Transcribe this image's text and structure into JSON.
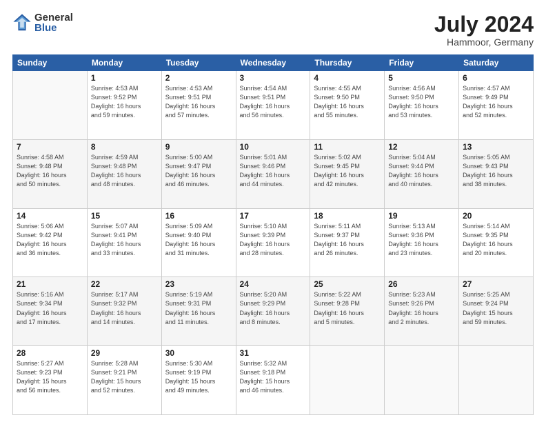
{
  "logo": {
    "general": "General",
    "blue": "Blue"
  },
  "header": {
    "month_year": "July 2024",
    "location": "Hammoor, Germany"
  },
  "weekdays": [
    "Sunday",
    "Monday",
    "Tuesday",
    "Wednesday",
    "Thursday",
    "Friday",
    "Saturday"
  ],
  "weeks": [
    [
      {
        "day": "",
        "info": ""
      },
      {
        "day": "1",
        "info": "Sunrise: 4:53 AM\nSunset: 9:52 PM\nDaylight: 16 hours\nand 59 minutes."
      },
      {
        "day": "2",
        "info": "Sunrise: 4:53 AM\nSunset: 9:51 PM\nDaylight: 16 hours\nand 57 minutes."
      },
      {
        "day": "3",
        "info": "Sunrise: 4:54 AM\nSunset: 9:51 PM\nDaylight: 16 hours\nand 56 minutes."
      },
      {
        "day": "4",
        "info": "Sunrise: 4:55 AM\nSunset: 9:50 PM\nDaylight: 16 hours\nand 55 minutes."
      },
      {
        "day": "5",
        "info": "Sunrise: 4:56 AM\nSunset: 9:50 PM\nDaylight: 16 hours\nand 53 minutes."
      },
      {
        "day": "6",
        "info": "Sunrise: 4:57 AM\nSunset: 9:49 PM\nDaylight: 16 hours\nand 52 minutes."
      }
    ],
    [
      {
        "day": "7",
        "info": "Sunrise: 4:58 AM\nSunset: 9:48 PM\nDaylight: 16 hours\nand 50 minutes."
      },
      {
        "day": "8",
        "info": "Sunrise: 4:59 AM\nSunset: 9:48 PM\nDaylight: 16 hours\nand 48 minutes."
      },
      {
        "day": "9",
        "info": "Sunrise: 5:00 AM\nSunset: 9:47 PM\nDaylight: 16 hours\nand 46 minutes."
      },
      {
        "day": "10",
        "info": "Sunrise: 5:01 AM\nSunset: 9:46 PM\nDaylight: 16 hours\nand 44 minutes."
      },
      {
        "day": "11",
        "info": "Sunrise: 5:02 AM\nSunset: 9:45 PM\nDaylight: 16 hours\nand 42 minutes."
      },
      {
        "day": "12",
        "info": "Sunrise: 5:04 AM\nSunset: 9:44 PM\nDaylight: 16 hours\nand 40 minutes."
      },
      {
        "day": "13",
        "info": "Sunrise: 5:05 AM\nSunset: 9:43 PM\nDaylight: 16 hours\nand 38 minutes."
      }
    ],
    [
      {
        "day": "14",
        "info": "Sunrise: 5:06 AM\nSunset: 9:42 PM\nDaylight: 16 hours\nand 36 minutes."
      },
      {
        "day": "15",
        "info": "Sunrise: 5:07 AM\nSunset: 9:41 PM\nDaylight: 16 hours\nand 33 minutes."
      },
      {
        "day": "16",
        "info": "Sunrise: 5:09 AM\nSunset: 9:40 PM\nDaylight: 16 hours\nand 31 minutes."
      },
      {
        "day": "17",
        "info": "Sunrise: 5:10 AM\nSunset: 9:39 PM\nDaylight: 16 hours\nand 28 minutes."
      },
      {
        "day": "18",
        "info": "Sunrise: 5:11 AM\nSunset: 9:37 PM\nDaylight: 16 hours\nand 26 minutes."
      },
      {
        "day": "19",
        "info": "Sunrise: 5:13 AM\nSunset: 9:36 PM\nDaylight: 16 hours\nand 23 minutes."
      },
      {
        "day": "20",
        "info": "Sunrise: 5:14 AM\nSunset: 9:35 PM\nDaylight: 16 hours\nand 20 minutes."
      }
    ],
    [
      {
        "day": "21",
        "info": "Sunrise: 5:16 AM\nSunset: 9:34 PM\nDaylight: 16 hours\nand 17 minutes."
      },
      {
        "day": "22",
        "info": "Sunrise: 5:17 AM\nSunset: 9:32 PM\nDaylight: 16 hours\nand 14 minutes."
      },
      {
        "day": "23",
        "info": "Sunrise: 5:19 AM\nSunset: 9:31 PM\nDaylight: 16 hours\nand 11 minutes."
      },
      {
        "day": "24",
        "info": "Sunrise: 5:20 AM\nSunset: 9:29 PM\nDaylight: 16 hours\nand 8 minutes."
      },
      {
        "day": "25",
        "info": "Sunrise: 5:22 AM\nSunset: 9:28 PM\nDaylight: 16 hours\nand 5 minutes."
      },
      {
        "day": "26",
        "info": "Sunrise: 5:23 AM\nSunset: 9:26 PM\nDaylight: 16 hours\nand 2 minutes."
      },
      {
        "day": "27",
        "info": "Sunrise: 5:25 AM\nSunset: 9:24 PM\nDaylight: 15 hours\nand 59 minutes."
      }
    ],
    [
      {
        "day": "28",
        "info": "Sunrise: 5:27 AM\nSunset: 9:23 PM\nDaylight: 15 hours\nand 56 minutes."
      },
      {
        "day": "29",
        "info": "Sunrise: 5:28 AM\nSunset: 9:21 PM\nDaylight: 15 hours\nand 52 minutes."
      },
      {
        "day": "30",
        "info": "Sunrise: 5:30 AM\nSunset: 9:19 PM\nDaylight: 15 hours\nand 49 minutes."
      },
      {
        "day": "31",
        "info": "Sunrise: 5:32 AM\nSunset: 9:18 PM\nDaylight: 15 hours\nand 46 minutes."
      },
      {
        "day": "",
        "info": ""
      },
      {
        "day": "",
        "info": ""
      },
      {
        "day": "",
        "info": ""
      }
    ]
  ]
}
